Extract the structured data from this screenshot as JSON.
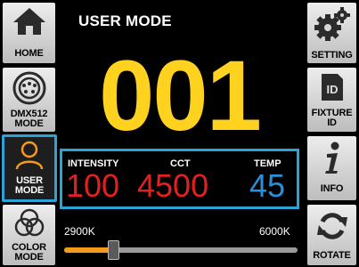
{
  "title": "USER MODE",
  "mode_number": "001",
  "left_nav": [
    {
      "label": "HOME",
      "icon": "home-icon"
    },
    {
      "label": "DMX512\nMODE",
      "icon": "dmx-connector-icon"
    },
    {
      "label": "USER\nMODE",
      "icon": "user-icon",
      "selected": true
    },
    {
      "label": "COLOR\nMODE",
      "icon": "color-circles-icon"
    }
  ],
  "right_nav": [
    {
      "label": "SETTING",
      "icon": "gears-icon"
    },
    {
      "label": "FIXTURE\nID",
      "icon": "id-badge-icon"
    },
    {
      "label": "INFO",
      "icon": "info-icon"
    },
    {
      "label": "ROTATE",
      "icon": "rotate-icon"
    }
  ],
  "params": {
    "intensity": {
      "label": "INTENSITY",
      "value": "100"
    },
    "cct": {
      "label": "CCT",
      "value": "4500"
    },
    "temp": {
      "label": "TEMP",
      "value": "45"
    }
  },
  "cct_slider": {
    "min_label": "2900K",
    "max_label": "6000K",
    "position": 0.21
  },
  "colors": {
    "accent": "#2aa3d8",
    "number": "#ffd21f",
    "value_red": "#e32020",
    "value_blue": "#2a8fd8",
    "slider_fill": "#f59a1c"
  }
}
